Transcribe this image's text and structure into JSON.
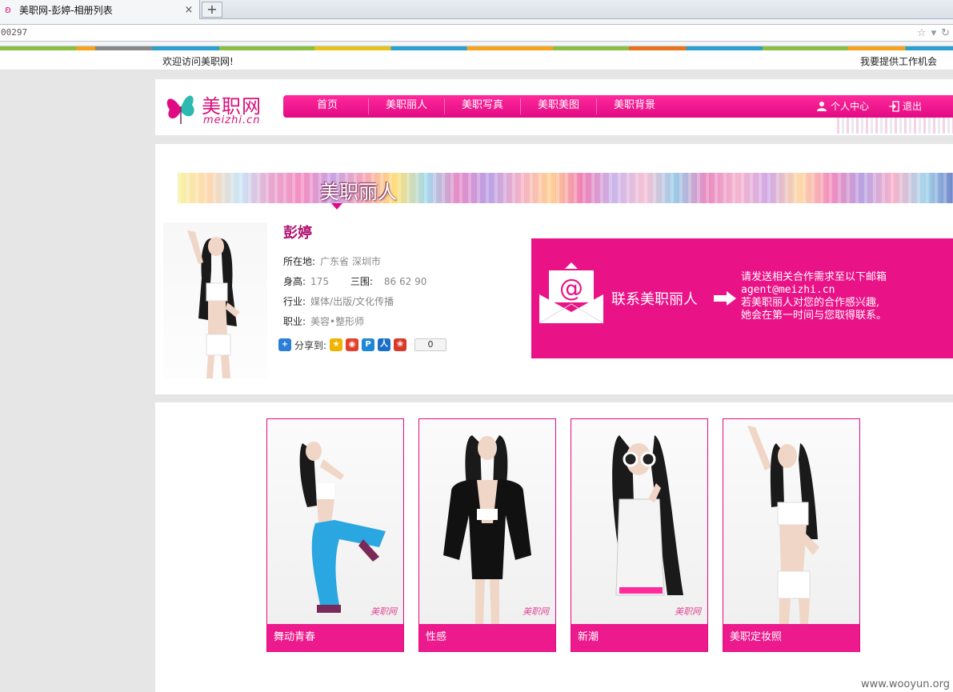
{
  "browser": {
    "tab_title": "美职网-彭婷-相册列表",
    "tab_close": "×",
    "new_tab": "+",
    "address": "00297"
  },
  "topbar": {
    "welcome": "欢迎访问美职网!",
    "provide_job": "我要提供工作机会"
  },
  "header": {
    "logo_text": "美职网",
    "logo_sub": "meizhi.cn",
    "nav": [
      "首页",
      "美职丽人",
      "美职写真",
      "美职美图",
      "美职背景"
    ],
    "user_center": "个人中心",
    "logout": "退出"
  },
  "profile": {
    "banner_title": "美职丽人",
    "name": "彭婷",
    "location_label": "所在地:",
    "location_value": "广东省 深圳市",
    "height_label": "身高:",
    "height_value": "175",
    "measure_label": "三围:",
    "measure_value": "86 62 90",
    "industry_label": "行业:",
    "industry_value": "媒体/出版/文化传播",
    "job_label": "职业:",
    "job_value": "美容•整形师",
    "share_label": "分享到:",
    "share_count": "0"
  },
  "contact": {
    "label": "联系美职丽人",
    "line1": "请发送相关合作需求至以下邮箱",
    "line2": "agent@meizhi.cn",
    "line3": "若美职丽人对您的合作感兴趣,",
    "line4": "她会在第一时间与您取得联系。"
  },
  "albums": [
    {
      "caption": "舞动青春",
      "watermark": "美职网"
    },
    {
      "caption": "性感",
      "watermark": "美职网"
    },
    {
      "caption": "新潮",
      "watermark": "美职网"
    },
    {
      "caption": "美职定妆照",
      "watermark": ""
    }
  ],
  "footer_watermark": "www.wooyun.org",
  "icons": {
    "favicon": "butterfly-icon",
    "star": "star-icon",
    "reload": "reload-icon",
    "user": "user-icon",
    "logout": "logout-icon",
    "mail": "mail-icon",
    "arrow": "arrow-right-icon"
  },
  "colors": {
    "brand_pink": "#e20a84",
    "caption_pink": "#ec1a8c",
    "name_color": "#b0126e"
  }
}
